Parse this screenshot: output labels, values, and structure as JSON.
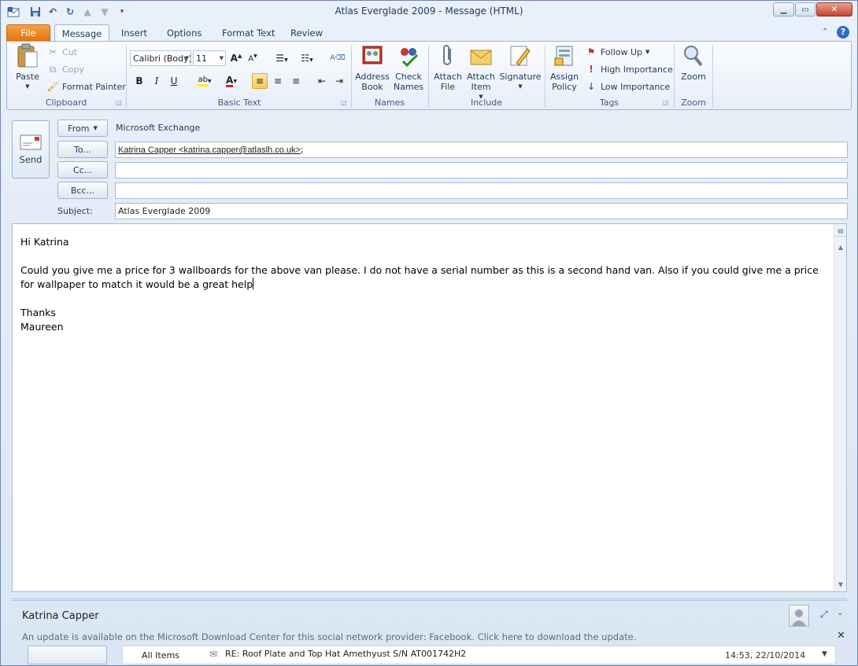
{
  "window": {
    "title": "Atlas Everglade 2009  -  Message (HTML)"
  },
  "tabs": [
    {
      "label": "File"
    },
    {
      "label": "Message"
    },
    {
      "label": "Insert"
    },
    {
      "label": "Options"
    },
    {
      "label": "Format Text"
    },
    {
      "label": "Review"
    }
  ],
  "ribbon": {
    "clipboard": {
      "paste": "Paste",
      "cut": "Cut",
      "copy": "Copy",
      "format_painter": "Format Painter",
      "label": "Clipboard"
    },
    "basic_text": {
      "font": "Calibri (Body)",
      "size": "11",
      "bold": "B",
      "italic": "I",
      "underline": "U",
      "label": "Basic Text"
    },
    "names": {
      "address_book": "Address Book",
      "check_names": "Check Names",
      "label": "Names"
    },
    "include": {
      "attach_file": "Attach File",
      "attach_item": "Attach Item",
      "signature": "Signature",
      "label": "Include"
    },
    "tags": {
      "assign_policy": "Assign Policy",
      "follow_up": "Follow Up",
      "high_importance": "High Importance",
      "low_importance": "Low Importance",
      "label": "Tags"
    },
    "zoom": {
      "zoom": "Zoom",
      "label": "Zoom"
    }
  },
  "header": {
    "send": "Send",
    "from_label": "From",
    "from_value": "Microsoft Exchange",
    "to_label": "To...",
    "to_value": "Katrina Capper <katrina.capper@atlaslh.co.uk>",
    "to_suffix": ";",
    "cc_label": "Cc...",
    "cc_value": "",
    "bcc_label": "Bcc...",
    "bcc_value": "",
    "subject_label": "Subject:",
    "subject_value": "Atlas Everglade 2009"
  },
  "body": {
    "greeting": "Hi Katrina",
    "paragraph": "Could you give me a price for 3 wallboards for the above van please.  I do not have a serial number as this is a second hand van.  Also if you could give me a price for wallpaper to match it would be a great help",
    "signoff": "Thanks",
    "name": "Maureen"
  },
  "people_pane": {
    "name": "Katrina Capper",
    "update_notice": "An update is available on the Microsoft Download Center for this social network provider: Facebook. Click here to download the update.",
    "feed_filter": "All Items",
    "feed_item": "RE: Roof Plate and Top Hat Amethyust S/N AT001742H2",
    "feed_time": "14:53, 22/10/2014"
  }
}
